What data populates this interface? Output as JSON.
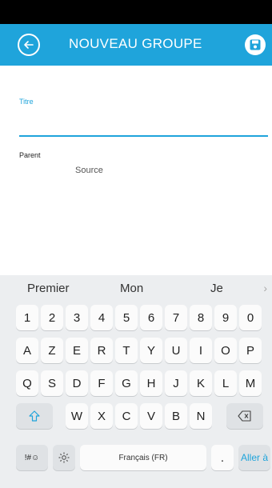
{
  "app_bar": {
    "title": "NOUVEAU GROUPE",
    "back_icon": "arrow-left-circle-icon",
    "save_icon": "floppy-disk-icon",
    "color": "#1fa4db"
  },
  "form": {
    "titre_label": "Titre",
    "titre_value": "",
    "parent_label": "Parent",
    "parent_value": "Source"
  },
  "keyboard": {
    "suggestions": [
      "Premier",
      "Mon",
      "Je"
    ],
    "rows": [
      [
        "1",
        "2",
        "3",
        "4",
        "5",
        "6",
        "7",
        "8",
        "9",
        "0"
      ],
      [
        "A",
        "Z",
        "E",
        "R",
        "T",
        "Y",
        "U",
        "I",
        "O",
        "P"
      ],
      [
        "Q",
        "S",
        "D",
        "F",
        "G",
        "H",
        "J",
        "K",
        "L",
        "M"
      ],
      [
        "W",
        "X",
        "C",
        "V",
        "B",
        "N"
      ]
    ],
    "symbols_key": "!#☺",
    "space_label": "Français (FR)",
    "period_key": ".",
    "enter_label": "Aller à"
  }
}
